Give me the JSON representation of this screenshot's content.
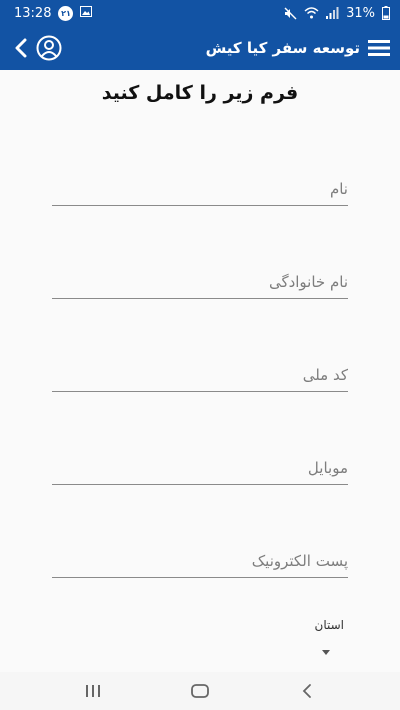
{
  "status_bar": {
    "time": "13:28",
    "notification_badge": "۲۱",
    "battery": "31%",
    "icons": [
      "notification-badge-icon",
      "image-icon",
      "mute-icon",
      "wifi-icon",
      "signal-icon",
      "battery-icon"
    ]
  },
  "app_bar": {
    "title": "توسعه سفر کیا کیش",
    "icons": [
      "back-icon",
      "account-icon",
      "menu-icon"
    ],
    "color": "#1253a4"
  },
  "form": {
    "heading": "فرم زیر را کامل کنید",
    "fields": [
      {
        "placeholder": "نام",
        "value": ""
      },
      {
        "placeholder": "نام خانوادگی",
        "value": ""
      },
      {
        "placeholder": "کد ملی",
        "value": ""
      },
      {
        "placeholder": "موبایل",
        "value": ""
      },
      {
        "placeholder": "پست الکترونیک",
        "value": ""
      }
    ],
    "province": {
      "label": "استان",
      "selected": ""
    }
  },
  "nav_bar": {
    "icons": [
      "recent-apps-icon",
      "home-icon",
      "back-nav-icon"
    ]
  }
}
